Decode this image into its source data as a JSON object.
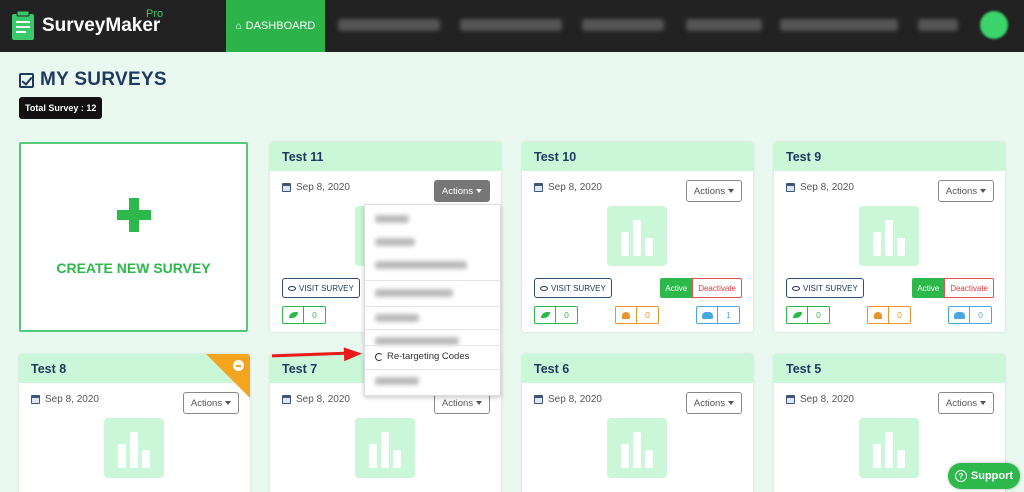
{
  "app": {
    "name": "SurveyMaker",
    "edition": "Pro"
  },
  "nav": {
    "active_label": "DASHBOARD"
  },
  "page": {
    "title": "MY SURVEYS",
    "total_badge": "Total Survey : 12"
  },
  "create": {
    "label": "CREATE NEW SURVEY"
  },
  "cards": [
    {
      "title": "Test 11",
      "date": "Sep 8, 2020",
      "actions": "Actions",
      "visit": "VISIT SURVEY"
    },
    {
      "title": "Test 10",
      "date": "Sep 8, 2020",
      "actions": "Actions",
      "visit": "VISIT SURVEY",
      "active": "Active",
      "deactivate": "Deactivate",
      "stat_leaf": "0",
      "stat_person": "0",
      "stat_people": "1"
    },
    {
      "title": "Test 9",
      "date": "Sep 8, 2020",
      "actions": "Actions",
      "visit": "VISIT SURVEY",
      "active": "Active",
      "deactivate": "Deactivate",
      "stat_leaf": "0",
      "stat_person": "0",
      "stat_people": "0"
    },
    {
      "title": "Test 8",
      "date": "Sep 8, 2020",
      "actions": "Actions"
    },
    {
      "title": "Test 7",
      "date": "Sep 8, 2020",
      "actions": "Actions"
    },
    {
      "title": "Test 6",
      "date": "Sep 8, 2020",
      "actions": "Actions"
    },
    {
      "title": "Test 5",
      "date": "Sep 8, 2020",
      "actions": "Actions"
    }
  ],
  "card11_stat_leaf": "0",
  "dropdown": {
    "visible_item": "Re-targeting Codes"
  },
  "support": {
    "label": "Support"
  },
  "colors": {
    "brand_green": "#2db84c",
    "header_bg": "#222222",
    "card_head": "#c9f7d8",
    "page_bg": "#e9f9ef",
    "annotation_arrow": "#ea1a1a"
  }
}
